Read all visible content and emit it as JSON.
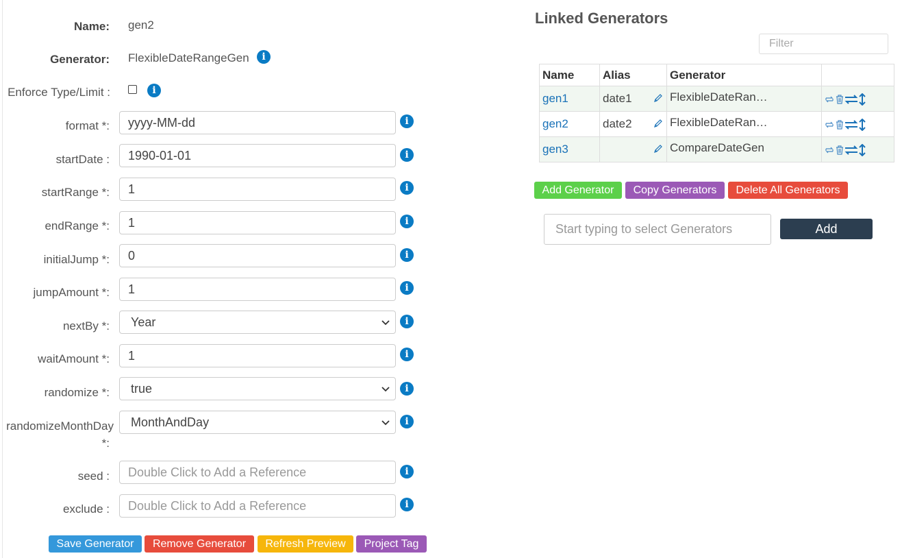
{
  "form": {
    "name_label": "Name:",
    "name_value": "gen2",
    "generator_label": "Generator:",
    "generator_value": "FlexibleDateRangeGen",
    "enforce_label": "Enforce Type/Limit :",
    "enforce_checked": false,
    "fields": {
      "format": {
        "label": "format *:",
        "value": "yyyy-MM-dd"
      },
      "startDate": {
        "label": "startDate :",
        "value": "1990-01-01"
      },
      "startRange": {
        "label": "startRange *:",
        "value": "1"
      },
      "endRange": {
        "label": "endRange *:",
        "value": "1"
      },
      "initialJump": {
        "label": "initialJump *:",
        "value": "0"
      },
      "jumpAmount": {
        "label": "jumpAmount *:",
        "value": "1"
      },
      "nextBy": {
        "label": "nextBy *:",
        "value": "Year"
      },
      "waitAmount": {
        "label": "waitAmount *:",
        "value": "1"
      },
      "randomize": {
        "label": "randomize *:",
        "value": "true"
      },
      "randomizeMonthDay": {
        "label_line1": "randomizeMonthDay",
        "label_line2": "*:",
        "value": "MonthAndDay"
      },
      "seed": {
        "label": "seed :",
        "placeholder": "Double Click to Add a Reference"
      },
      "exclude": {
        "label": "exclude :",
        "placeholder": "Double Click to Add a Reference"
      }
    }
  },
  "buttons": {
    "save": "Save Generator",
    "remove": "Remove Generator",
    "refresh": "Refresh Preview",
    "project_tag": "Project Tag"
  },
  "linked": {
    "title": "Linked Generators",
    "filter_placeholder": "Filter",
    "headers": {
      "name": "Name",
      "alias": "Alias",
      "generator": "Generator"
    },
    "rows": [
      {
        "name": "gen1",
        "alias": "date1",
        "generator": "FlexibleDateRan…"
      },
      {
        "name": "gen2",
        "alias": "date2",
        "generator": "FlexibleDateRan…"
      },
      {
        "name": "gen3",
        "alias": "",
        "generator": "CompareDateGen"
      }
    ],
    "add_generator": "Add Generator",
    "copy_generators": "Copy Generators",
    "delete_all": "Delete All Generators",
    "select_placeholder": "Start typing to select Generators",
    "add": "Add"
  },
  "colors": {
    "save": "#3498db",
    "remove": "#e74c3c",
    "refresh": "#f6b60b",
    "project_tag": "#9b59b6",
    "add_generator": "#5cd04a",
    "copy_generators": "#9b59b6",
    "delete_all": "#e74c3c",
    "add": "#2c3e50",
    "info": "#0a7bc4",
    "link": "#1a72b8"
  },
  "icons": {
    "info": "info-icon",
    "pencil": "pencil-icon",
    "actions": [
      "refresh-icon",
      "trash-icon",
      "swap-horizontal-icon",
      "swap-vertical-icon"
    ]
  }
}
